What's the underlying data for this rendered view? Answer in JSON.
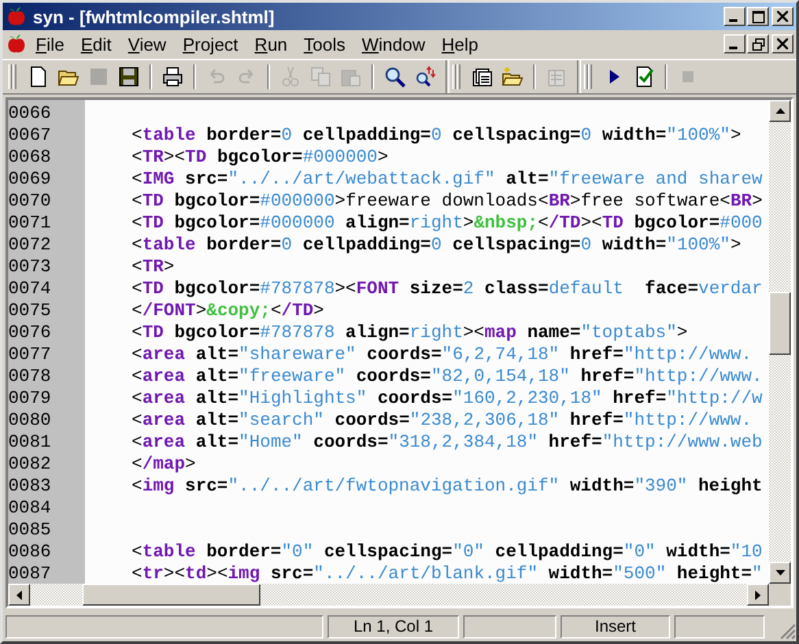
{
  "window": {
    "title": "syn - [fwhtmlcompiler.shtml]"
  },
  "menu": [
    "File",
    "Edit",
    "View",
    "Project",
    "Run",
    "Tools",
    "Window",
    "Help"
  ],
  "toolbar": [
    {
      "kind": "new",
      "disabled": false
    },
    {
      "kind": "open",
      "disabled": false
    },
    {
      "kind": "blank",
      "disabled": true
    },
    {
      "kind": "save",
      "disabled": false
    },
    {
      "kind": "separator"
    },
    {
      "kind": "print",
      "disabled": false
    },
    {
      "kind": "separator"
    },
    {
      "kind": "undo",
      "disabled": true
    },
    {
      "kind": "redo",
      "disabled": true
    },
    {
      "kind": "separator"
    },
    {
      "kind": "cut",
      "disabled": true
    },
    {
      "kind": "copy",
      "disabled": true
    },
    {
      "kind": "paste",
      "disabled": true
    },
    {
      "kind": "separator"
    },
    {
      "kind": "find",
      "disabled": false
    },
    {
      "kind": "replace",
      "disabled": false
    },
    {
      "kind": "band"
    },
    {
      "kind": "new-project",
      "disabled": false
    },
    {
      "kind": "open-project",
      "disabled": false
    },
    {
      "kind": "separator"
    },
    {
      "kind": "options",
      "disabled": true
    },
    {
      "kind": "band"
    },
    {
      "kind": "run",
      "disabled": false
    },
    {
      "kind": "check",
      "disabled": false
    },
    {
      "kind": "separator"
    },
    {
      "kind": "stop",
      "disabled": true
    }
  ],
  "editor": {
    "lines": [
      {
        "number": "0066"
      },
      {
        "number": "0067",
        "tokens": [
          {
            "kind": "punct",
            "text": "<"
          },
          {
            "kind": "tag",
            "text": "table"
          },
          {
            "kind": "attr",
            "text": " border="
          },
          {
            "kind": "value",
            "text": "0"
          },
          {
            "kind": "attr",
            "text": " cellpadding="
          },
          {
            "kind": "value",
            "text": "0"
          },
          {
            "kind": "attr",
            "text": " cellspacing="
          },
          {
            "kind": "value",
            "text": "0"
          },
          {
            "kind": "attr",
            "text": " width="
          },
          {
            "kind": "value",
            "text": "\"100%\""
          },
          {
            "kind": "punct",
            "text": ">"
          }
        ]
      },
      {
        "number": "0068",
        "tokens": [
          {
            "kind": "punct",
            "text": "<"
          },
          {
            "kind": "tag",
            "text": "TR"
          },
          {
            "kind": "punct",
            "text": "><"
          },
          {
            "kind": "tag",
            "text": "TD"
          },
          {
            "kind": "attr",
            "text": " bgcolor="
          },
          {
            "kind": "value",
            "text": "#000000"
          },
          {
            "kind": "punct",
            "text": ">"
          }
        ]
      },
      {
        "number": "0069",
        "tokens": [
          {
            "kind": "punct",
            "text": "<"
          },
          {
            "kind": "tag",
            "text": "IMG"
          },
          {
            "kind": "attr",
            "text": " src="
          },
          {
            "kind": "value",
            "text": "\"../../art/webattack.gif\""
          },
          {
            "kind": "attr",
            "text": " alt="
          },
          {
            "kind": "value",
            "text": "\"freeware and sharew"
          }
        ]
      },
      {
        "number": "0070",
        "tokens": [
          {
            "kind": "punct",
            "text": "<"
          },
          {
            "kind": "tag",
            "text": "TD"
          },
          {
            "kind": "attr",
            "text": " bgcolor="
          },
          {
            "kind": "value",
            "text": "#000000"
          },
          {
            "kind": "punct",
            "text": ">"
          },
          {
            "kind": "text",
            "text": "freeware downloads"
          },
          {
            "kind": "punct",
            "text": "<"
          },
          {
            "kind": "tag",
            "text": "BR"
          },
          {
            "kind": "punct",
            "text": ">"
          },
          {
            "kind": "text",
            "text": "free software"
          },
          {
            "kind": "punct",
            "text": "<"
          },
          {
            "kind": "tag",
            "text": "BR"
          },
          {
            "kind": "punct",
            "text": ">"
          }
        ]
      },
      {
        "number": "0071",
        "tokens": [
          {
            "kind": "punct",
            "text": "<"
          },
          {
            "kind": "tag",
            "text": "TD"
          },
          {
            "kind": "attr",
            "text": " bgcolor="
          },
          {
            "kind": "value",
            "text": "#000000"
          },
          {
            "kind": "attr",
            "text": " align="
          },
          {
            "kind": "value",
            "text": "right"
          },
          {
            "kind": "punct",
            "text": ">"
          },
          {
            "kind": "entity",
            "text": "&nbsp;"
          },
          {
            "kind": "punct",
            "text": "<"
          },
          {
            "kind": "tag",
            "text": "/TD"
          },
          {
            "kind": "punct",
            "text": "><"
          },
          {
            "kind": "tag",
            "text": "TD"
          },
          {
            "kind": "attr",
            "text": " bgcolor="
          },
          {
            "kind": "value",
            "text": "#000"
          }
        ]
      },
      {
        "number": "0072",
        "tokens": [
          {
            "kind": "punct",
            "text": "<"
          },
          {
            "kind": "tag",
            "text": "table"
          },
          {
            "kind": "attr",
            "text": " border="
          },
          {
            "kind": "value",
            "text": "0"
          },
          {
            "kind": "attr",
            "text": " cellpadding="
          },
          {
            "kind": "value",
            "text": "0"
          },
          {
            "kind": "attr",
            "text": " cellspacing="
          },
          {
            "kind": "value",
            "text": "0"
          },
          {
            "kind": "attr",
            "text": " width="
          },
          {
            "kind": "value",
            "text": "\"100%\""
          },
          {
            "kind": "punct",
            "text": ">"
          }
        ]
      },
      {
        "number": "0073",
        "tokens": [
          {
            "kind": "punct",
            "text": "<"
          },
          {
            "kind": "tag",
            "text": "TR"
          },
          {
            "kind": "punct",
            "text": ">"
          }
        ]
      },
      {
        "number": "0074",
        "tokens": [
          {
            "kind": "punct",
            "text": "<"
          },
          {
            "kind": "tag",
            "text": "TD"
          },
          {
            "kind": "attr",
            "text": " bgcolor="
          },
          {
            "kind": "value",
            "text": "#787878"
          },
          {
            "kind": "punct",
            "text": "><"
          },
          {
            "kind": "tag",
            "text": "FONT"
          },
          {
            "kind": "attr",
            "text": " size="
          },
          {
            "kind": "value",
            "text": "2"
          },
          {
            "kind": "attr",
            "text": " class="
          },
          {
            "kind": "value",
            "text": "default"
          },
          {
            "kind": "attr",
            "text": "  face="
          },
          {
            "kind": "value",
            "text": "verdar"
          }
        ]
      },
      {
        "number": "0075",
        "tokens": [
          {
            "kind": "punct",
            "text": "<"
          },
          {
            "kind": "tag",
            "text": "/FONT"
          },
          {
            "kind": "punct",
            "text": ">"
          },
          {
            "kind": "entity",
            "text": "&copy;"
          },
          {
            "kind": "punct",
            "text": "<"
          },
          {
            "kind": "tag",
            "text": "/TD"
          },
          {
            "kind": "punct",
            "text": ">"
          }
        ]
      },
      {
        "number": "0076",
        "tokens": [
          {
            "kind": "punct",
            "text": "<"
          },
          {
            "kind": "tag",
            "text": "TD"
          },
          {
            "kind": "attr",
            "text": " bgcolor="
          },
          {
            "kind": "value",
            "text": "#787878"
          },
          {
            "kind": "attr",
            "text": " align="
          },
          {
            "kind": "value",
            "text": "right"
          },
          {
            "kind": "punct",
            "text": "><"
          },
          {
            "kind": "tag",
            "text": "map"
          },
          {
            "kind": "attr",
            "text": " name="
          },
          {
            "kind": "value",
            "text": "\"toptabs\""
          },
          {
            "kind": "punct",
            "text": ">"
          }
        ]
      },
      {
        "number": "0077",
        "tokens": [
          {
            "kind": "punct",
            "text": "<"
          },
          {
            "kind": "tag",
            "text": "area"
          },
          {
            "kind": "attr",
            "text": " alt="
          },
          {
            "kind": "value",
            "text": "\"shareware\""
          },
          {
            "kind": "attr",
            "text": " coords="
          },
          {
            "kind": "value",
            "text": "\"6,2,74,18\""
          },
          {
            "kind": "attr",
            "text": " href="
          },
          {
            "kind": "value",
            "text": "\"http://www."
          }
        ]
      },
      {
        "number": "0078",
        "tokens": [
          {
            "kind": "punct",
            "text": "<"
          },
          {
            "kind": "tag",
            "text": "area"
          },
          {
            "kind": "attr",
            "text": " alt="
          },
          {
            "kind": "value",
            "text": "\"freeware\""
          },
          {
            "kind": "attr",
            "text": " coords="
          },
          {
            "kind": "value",
            "text": "\"82,0,154,18\""
          },
          {
            "kind": "attr",
            "text": " href="
          },
          {
            "kind": "value",
            "text": "\"http://www."
          }
        ]
      },
      {
        "number": "0079",
        "tokens": [
          {
            "kind": "punct",
            "text": "<"
          },
          {
            "kind": "tag",
            "text": "area"
          },
          {
            "kind": "attr",
            "text": " alt="
          },
          {
            "kind": "value",
            "text": "\"Highlights\""
          },
          {
            "kind": "attr",
            "text": " coords="
          },
          {
            "kind": "value",
            "text": "\"160,2,230,18\""
          },
          {
            "kind": "attr",
            "text": " href="
          },
          {
            "kind": "value",
            "text": "\"http://w"
          }
        ]
      },
      {
        "number": "0080",
        "tokens": [
          {
            "kind": "punct",
            "text": "<"
          },
          {
            "kind": "tag",
            "text": "area"
          },
          {
            "kind": "attr",
            "text": " alt="
          },
          {
            "kind": "value",
            "text": "\"search\""
          },
          {
            "kind": "attr",
            "text": " coords="
          },
          {
            "kind": "value",
            "text": "\"238,2,306,18\""
          },
          {
            "kind": "attr",
            "text": " href="
          },
          {
            "kind": "value",
            "text": "\"http://www."
          }
        ]
      },
      {
        "number": "0081",
        "tokens": [
          {
            "kind": "punct",
            "text": "<"
          },
          {
            "kind": "tag",
            "text": "area"
          },
          {
            "kind": "attr",
            "text": " alt="
          },
          {
            "kind": "value",
            "text": "\"Home\""
          },
          {
            "kind": "attr",
            "text": " coords="
          },
          {
            "kind": "value",
            "text": "\"318,2,384,18\""
          },
          {
            "kind": "attr",
            "text": " href="
          },
          {
            "kind": "value",
            "text": "\"http://www.web"
          }
        ]
      },
      {
        "number": "0082",
        "tokens": [
          {
            "kind": "punct",
            "text": "<"
          },
          {
            "kind": "tag",
            "text": "/map"
          },
          {
            "kind": "punct",
            "text": ">"
          }
        ]
      },
      {
        "number": "0083",
        "tokens": [
          {
            "kind": "punct",
            "text": "<"
          },
          {
            "kind": "tag",
            "text": "img"
          },
          {
            "kind": "attr",
            "text": " src="
          },
          {
            "kind": "value",
            "text": "\"../../art/fwtopnavigation.gif\""
          },
          {
            "kind": "attr",
            "text": " width="
          },
          {
            "kind": "value",
            "text": "\"390\""
          },
          {
            "kind": "attr",
            "text": " height"
          }
        ]
      },
      {
        "number": "0084"
      },
      {
        "number": "0085"
      },
      {
        "number": "0086",
        "tokens": [
          {
            "kind": "punct",
            "text": "<"
          },
          {
            "kind": "tag",
            "text": "table"
          },
          {
            "kind": "attr",
            "text": " border="
          },
          {
            "kind": "value",
            "text": "\"0\""
          },
          {
            "kind": "attr",
            "text": " cellspacing="
          },
          {
            "kind": "value",
            "text": "\"0\""
          },
          {
            "kind": "attr",
            "text": " cellpadding="
          },
          {
            "kind": "value",
            "text": "\"0\""
          },
          {
            "kind": "attr",
            "text": " width="
          },
          {
            "kind": "value",
            "text": "\"10"
          }
        ]
      },
      {
        "number": "0087",
        "tokens": [
          {
            "kind": "punct",
            "text": "<"
          },
          {
            "kind": "tag",
            "text": "tr"
          },
          {
            "kind": "punct",
            "text": "><"
          },
          {
            "kind": "tag",
            "text": "td"
          },
          {
            "kind": "punct",
            "text": "><"
          },
          {
            "kind": "tag",
            "text": "img"
          },
          {
            "kind": "attr",
            "text": " src="
          },
          {
            "kind": "value",
            "text": "\"../../art/blank.gif\""
          },
          {
            "kind": "attr",
            "text": " width="
          },
          {
            "kind": "value",
            "text": "\"500\""
          },
          {
            "kind": "attr",
            "text": " height="
          },
          {
            "kind": "value",
            "text": "\""
          }
        ]
      }
    ]
  },
  "status_bar": {
    "position": "Ln 1, Col 1",
    "mode": "Insert"
  }
}
